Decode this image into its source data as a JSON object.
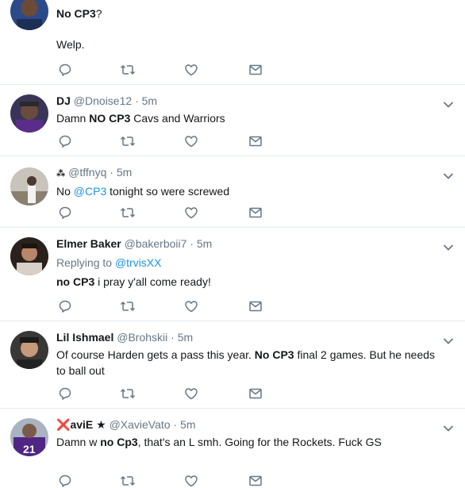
{
  "tweets": [
    {
      "name": "",
      "handle": "",
      "time": "",
      "segments": [
        {
          "t": "No CP3",
          "s": "bold"
        },
        {
          "t": "?",
          "s": "normal"
        }
      ],
      "second_line": "Welp."
    },
    {
      "name": "DJ",
      "handle": "@Dnoise12",
      "time": "5m",
      "segments": [
        {
          "t": "Damn ",
          "s": "normal"
        },
        {
          "t": "NO CP3",
          "s": "bold"
        },
        {
          "t": " Cavs and Warriors",
          "s": "normal"
        }
      ]
    },
    {
      "name": "",
      "handle": "@tffnyq",
      "time": "5m",
      "segments": [
        {
          "t": "No ",
          "s": "normal"
        },
        {
          "t": "@CP3",
          "s": "link"
        },
        {
          "t": " tonight so were screwed",
          "s": "normal"
        }
      ]
    },
    {
      "name": "Elmer Baker",
      "handle": "@bakerboii7",
      "time": "5m",
      "reply_prefix": "Replying to ",
      "reply_to": "@trvisXX",
      "segments": [
        {
          "t": "no CP3",
          "s": "bold"
        },
        {
          "t": " i pray y'all come ready!",
          "s": "normal"
        }
      ]
    },
    {
      "name": "Lil Ishmael",
      "handle": "@Brohskii",
      "time": "5m",
      "segments": [
        {
          "t": "Of course Harden gets a pass this year. ",
          "s": "normal"
        },
        {
          "t": "No CP3",
          "s": "bold"
        },
        {
          "t": " final 2 games. But he needs to ball out",
          "s": "normal"
        }
      ]
    },
    {
      "name": "aviE ★",
      "name_prefix_mark": "❌",
      "handle": "@XavieVato",
      "time": "5m",
      "segments": [
        {
          "t": "Damn w ",
          "s": "normal"
        },
        {
          "t": "no Cp3",
          "s": "bold"
        },
        {
          "t": ", that's an L smh. Going for the Rockets. Fuck GS",
          "s": "normal"
        }
      ]
    }
  ],
  "icons": {
    "reply": "reply-icon",
    "retweet": "retweet-icon",
    "like": "heart-icon",
    "dm": "envelope-icon",
    "more": "chevron-down-icon"
  },
  "colors": {
    "link": "#1b95e0",
    "muted": "#657786",
    "text": "#14171a",
    "divider": "#e6ecf0"
  }
}
